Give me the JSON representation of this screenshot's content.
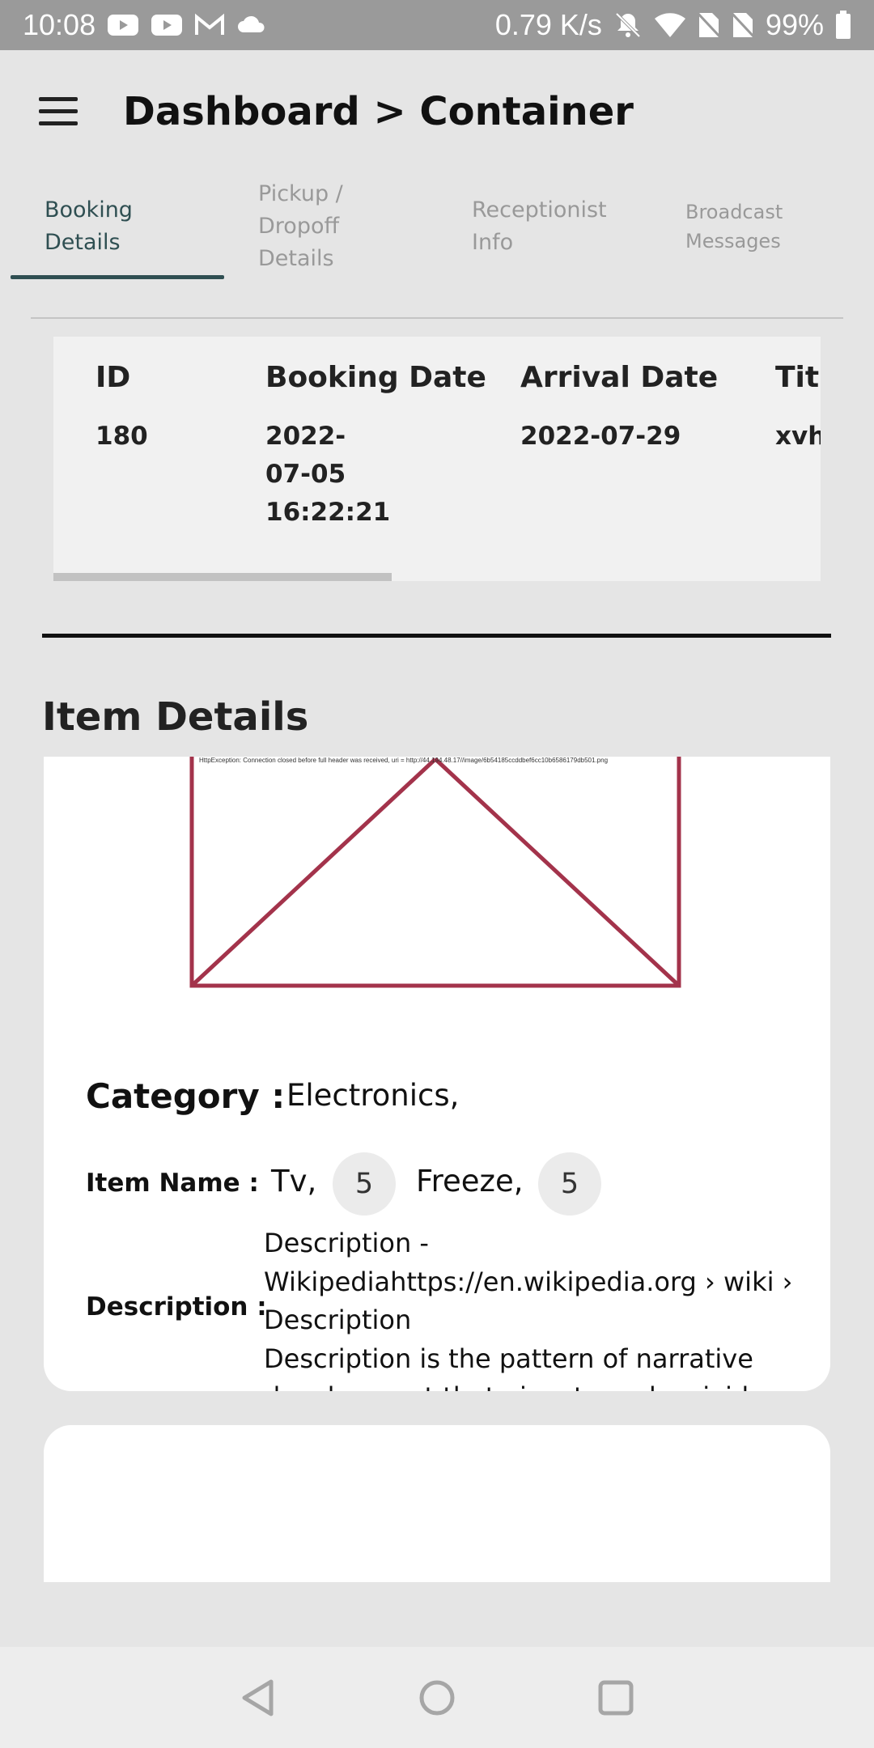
{
  "status_bar": {
    "time": "10:08",
    "network_speed": "0.79 K/s",
    "battery": "99%",
    "icons": [
      "youtube-icon",
      "youtube-icon",
      "gmail-icon",
      "cloud-icon",
      "mute-icon",
      "wifi-icon",
      "no-sim-icon",
      "no-sim-icon",
      "battery-icon"
    ]
  },
  "header": {
    "title": "Dashboard > Container",
    "menu_icon": "hamburger-menu-icon"
  },
  "tabs": [
    {
      "label_lines": [
        "Booking",
        "Details"
      ],
      "active": true
    },
    {
      "label_lines": [
        "Pickup /",
        "Dropoff",
        "Details"
      ],
      "active": false
    },
    {
      "label_lines": [
        "Receptionist",
        "Info"
      ],
      "active": false
    },
    {
      "label_lines": [
        "Broadcast",
        "Messages"
      ],
      "active": false
    }
  ],
  "booking_table": {
    "headers": [
      "ID",
      "Booking Date",
      "Arrival Date",
      "Titl"
    ],
    "row": [
      "180",
      "2022-07-05\n16:22:21",
      "2022-07-29",
      "xvh"
    ]
  },
  "item_details": {
    "title": "Item Details",
    "image_error": "HttpException: Connection closed before full header was received, uri = http://44.194.48.17//image/6b54185ccddbef6cc10b6586179db501.png",
    "category_label": "Category :",
    "category_value": "Electronics,",
    "item_name_label": "Item Name :",
    "items": [
      {
        "name": "Tv,",
        "qty": "5"
      },
      {
        "name": "Freeze,",
        "qty": "5"
      }
    ],
    "description_label": "Description :",
    "description_lines": [
      "Description -",
      "Wikipediahttps://en.wikipedia.org › wiki ›",
      "Description",
      "Description is the pattern of narrative",
      "development that aims to make vivid"
    ]
  },
  "colors": {
    "status_bar": "#9a9a9a",
    "background": "#e5e5e5",
    "active_tab": "#2f4f52",
    "broken_image_frame": "#a3334b"
  },
  "nav_bar": {
    "icons": [
      "back-icon",
      "home-icon",
      "recents-icon"
    ]
  }
}
